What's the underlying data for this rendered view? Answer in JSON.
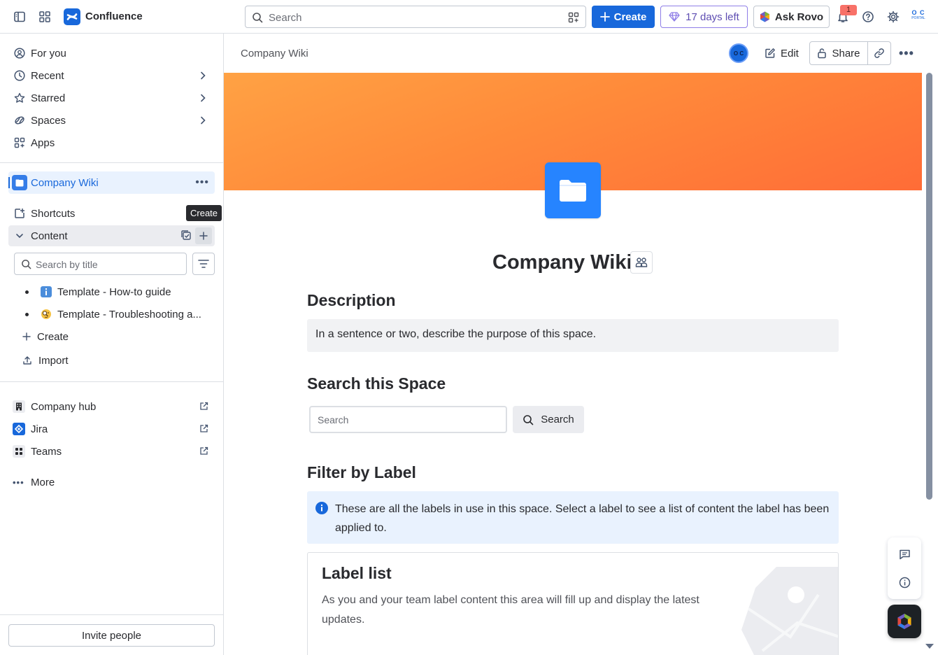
{
  "topbar": {
    "app_name": "Confluence",
    "search_placeholder": "Search",
    "create_label": "Create",
    "trial_label": "17 days left",
    "ask_rovo_label": "Ask Rovo",
    "notification_count": "1",
    "account_initials": "O C",
    "account_caption": "PORTAL",
    "icons": [
      "sidebar-toggle-icon",
      "app-switcher-icon",
      "confluence-logo-icon",
      "search-icon",
      "filter-icon",
      "plus-icon",
      "gem-icon",
      "rovo-icon",
      "bell-icon",
      "help-icon",
      "gear-icon"
    ],
    "colors": {
      "primary": "#1868db",
      "trial": "#5e4db2",
      "badge": "#f87168"
    }
  },
  "sidebar": {
    "nav": [
      {
        "label": "For you",
        "icon": "person-circle-icon"
      },
      {
        "label": "Recent",
        "icon": "clock-icon"
      },
      {
        "label": "Starred",
        "icon": "star-icon"
      },
      {
        "label": "Spaces",
        "icon": "spaces-icon"
      },
      {
        "label": "Apps",
        "icon": "apps-icon"
      }
    ],
    "space": {
      "name": "Company Wiki"
    },
    "tooltip": "Create",
    "shortcuts_label": "Shortcuts",
    "content_label": "Content",
    "title_search_placeholder": "Search by title",
    "tree": [
      {
        "label": "Template - How-to guide",
        "icon": "info-icon"
      },
      {
        "label": "Template - Troubleshooting a...",
        "icon": "magnifier-emoji-icon"
      }
    ],
    "create_label": "Create",
    "import_label": "Import",
    "apps": [
      {
        "label": "Company hub",
        "icon": "building-icon"
      },
      {
        "label": "Jira",
        "icon": "jira-icon"
      },
      {
        "label": "Teams",
        "icon": "teams-icon"
      }
    ],
    "more_label": "More",
    "invite_label": "Invite people"
  },
  "page": {
    "breadcrumb": "Company Wiki",
    "avatar_initials": "O C",
    "edit_label": "Edit",
    "share_label": "Share",
    "title": "Company Wiki",
    "description_heading": "Description",
    "description_text": "In a sentence or two, describe the purpose of this space.",
    "search_heading": "Search this Space",
    "search_placeholder": "Search",
    "search_button": "Search",
    "filter_heading": "Filter by Label",
    "info_text": "These are all the labels in use in this space. Select a label to see a list of content the label has been applied to.",
    "label_list_title": "Label list",
    "label_list_text": "As you and your team label content this area will fill up and display the latest updates.",
    "colors": {
      "banner_from": "#ffa244",
      "banner_to": "#ff6c37",
      "tile": "#2684ff",
      "info_bg": "#e9f2fe"
    }
  }
}
